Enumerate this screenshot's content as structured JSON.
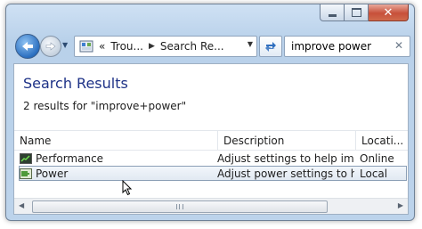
{
  "window": {
    "controls": {
      "close_glyph": "✕"
    }
  },
  "navigation": {
    "back_icon": "back-arrow-icon",
    "forward_icon": "forward-arrow-icon",
    "recent_pages_glyph": "▼"
  },
  "address_bar": {
    "overflow_glyph": "«",
    "segments": [
      "Trou...",
      "Search Re..."
    ],
    "separator_glyph": "▶",
    "dropdown_glyph": "▼"
  },
  "search": {
    "value": "improve power",
    "clear_glyph": "✕"
  },
  "content": {
    "title": "Search Results",
    "count_text": "2 results for \"improve+power\"",
    "columns": [
      "Name",
      "Description",
      "Locati..."
    ],
    "rows": [
      {
        "name": "Performance",
        "description": "Adjust settings to help im...",
        "location": "Online"
      },
      {
        "name": "Power",
        "description": "Adjust power settings to h...",
        "location": "Local"
      }
    ]
  },
  "scrollbar": {
    "left_glyph": "◀",
    "right_glyph": "▶"
  },
  "colors": {
    "title_text": "#1e3287",
    "selection_border": "#8c9fb6",
    "close_button": "#c7503a"
  }
}
